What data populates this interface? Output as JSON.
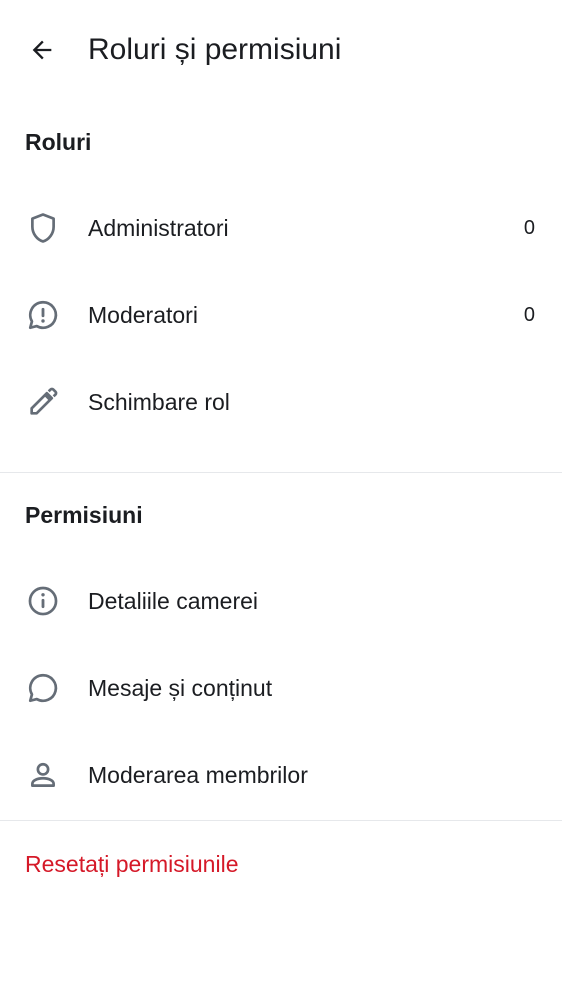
{
  "header": {
    "title": "Roluri și permisiuni",
    "back_icon": "arrow-left-icon"
  },
  "roles_section": {
    "title": "Roluri",
    "items": [
      {
        "label": "Administratori",
        "count": "0",
        "icon": "shield-icon"
      },
      {
        "label": "Moderatori",
        "count": "0",
        "icon": "chat-alert-icon"
      },
      {
        "label": "Schimbare rol",
        "icon": "pencil-icon"
      }
    ]
  },
  "permissions_section": {
    "title": "Permisiuni",
    "items": [
      {
        "label": "Detaliile camerei",
        "icon": "info-icon"
      },
      {
        "label": "Mesaje și conținut",
        "icon": "chat-bubble-icon"
      },
      {
        "label": "Moderarea membrilor",
        "icon": "user-icon"
      }
    ]
  },
  "reset": {
    "label": "Resetați permisiunile",
    "color": "#d51928"
  },
  "colors": {
    "text": "#1b1d21",
    "icon": "#656d77",
    "divider": "#e6e8eb",
    "danger": "#d51928"
  }
}
